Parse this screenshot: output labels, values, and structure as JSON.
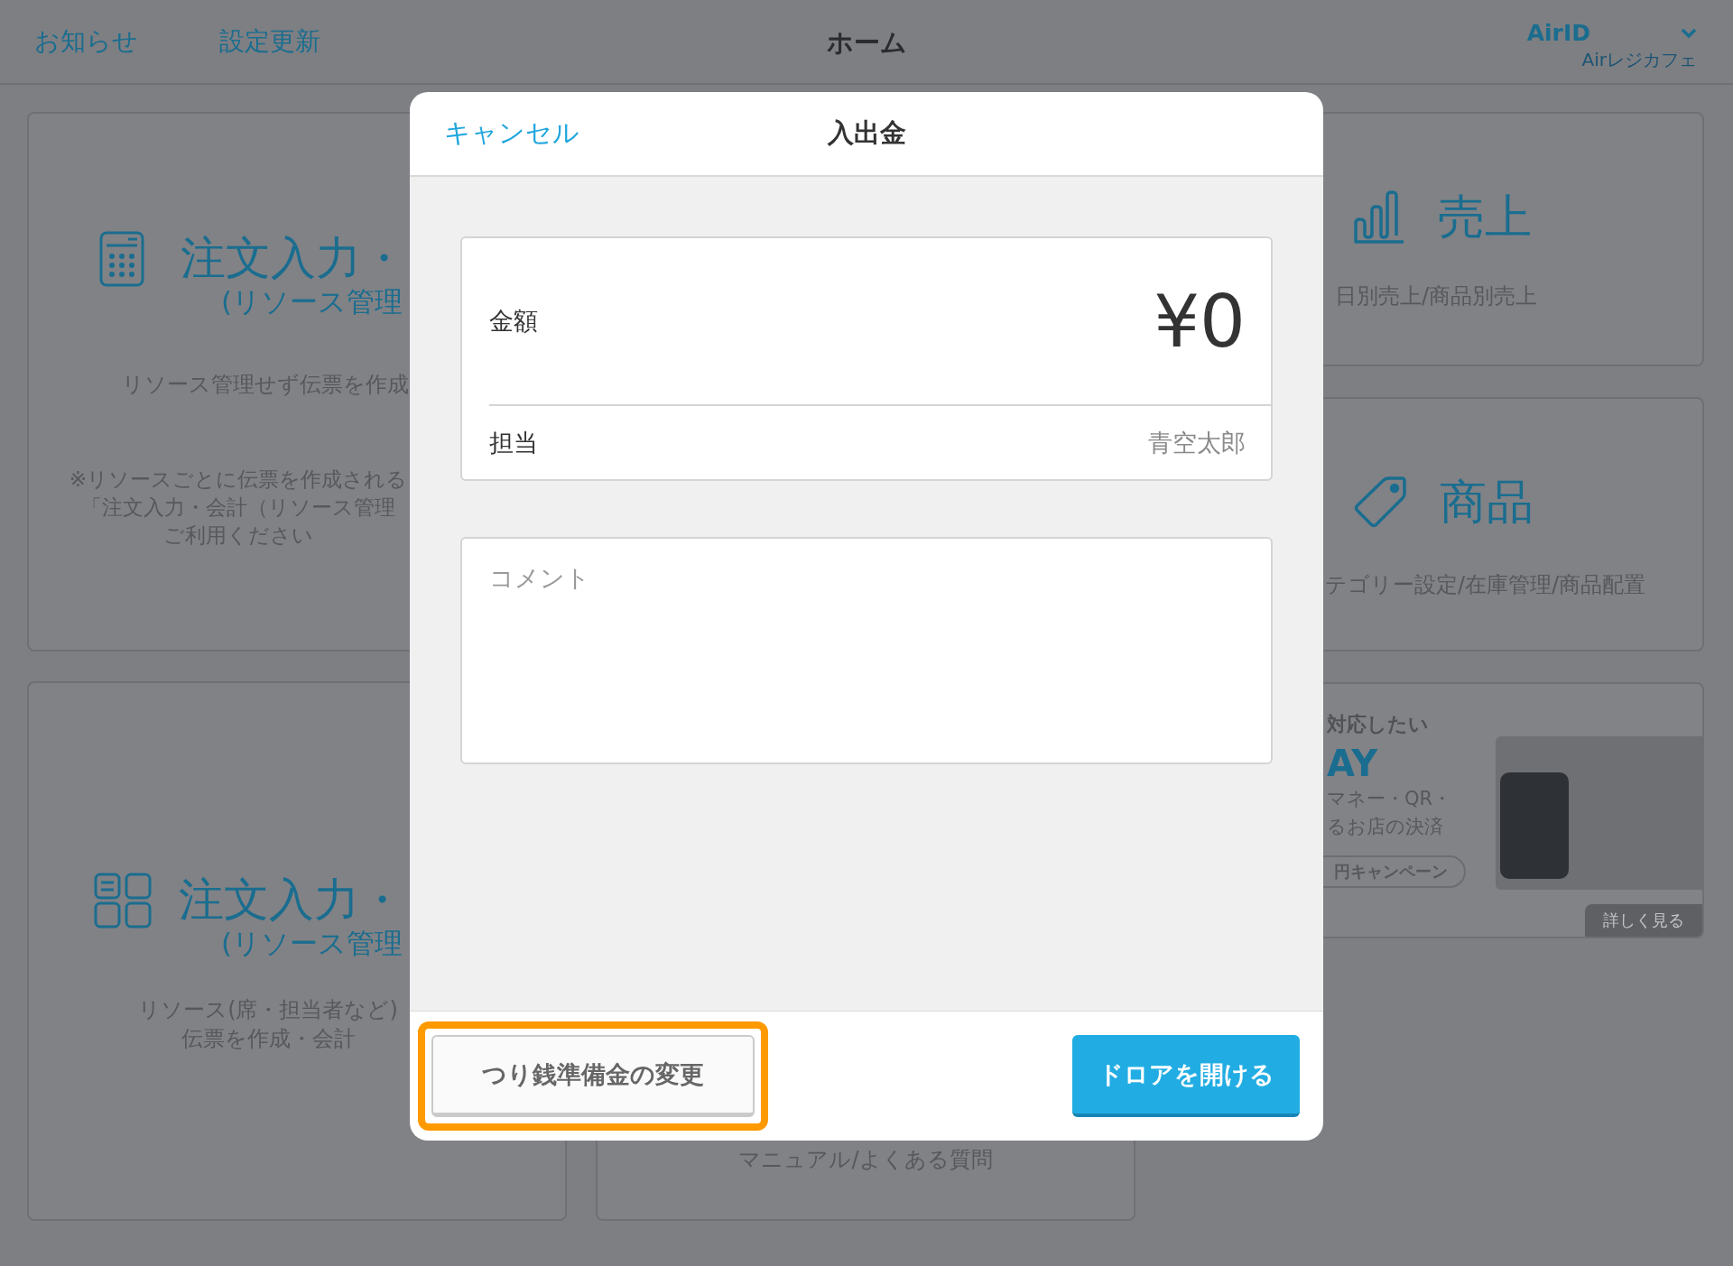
{
  "header": {
    "links": [
      {
        "label": "お知らせ"
      },
      {
        "label": "設定更新"
      }
    ],
    "title": "ホーム",
    "account": {
      "id": "AirID",
      "store": "Airレジカフェ"
    }
  },
  "left_cards": [
    {
      "kind": "calculator",
      "title": "注文入力・",
      "subtitle": "(リソース管理",
      "description": "リソース管理せず伝票を作成",
      "note": [
        "※リソースごとに伝票を作成される",
        "「注文入力・会計（リソース管理",
        "ご利用ください"
      ]
    },
    {
      "kind": "tiles",
      "title": "注文入力・",
      "subtitle": "(リソース管理",
      "description": [
        "リソース(席・担当者など)",
        "伝票を作成・会計"
      ]
    }
  ],
  "center_card": {
    "description": "マニュアル/よくある質問"
  },
  "right_cards": [
    {
      "kind": "bar-chart",
      "title": "売上",
      "description": "日別売上/商品別売上"
    },
    {
      "kind": "tag",
      "title": "商品",
      "description": "テゴリー設定/在庫管理/商品配置"
    }
  ],
  "promo": {
    "headline": "対応したい",
    "logo": "AY",
    "body": [
      "マネー・QR・",
      "るお店の決済"
    ],
    "campaign": "円キャンペーン",
    "more": "詳しく見る"
  },
  "modal": {
    "cancel": "キャンセル",
    "title": "入出金",
    "amount_label": "金額",
    "amount": "¥0",
    "staff_label": "担当",
    "staff": "青空太郎",
    "comment_placeholder": "コメント",
    "buttons": [
      {
        "kind": "secondary",
        "label": "つり銭準備金の変更",
        "highlighted": true
      },
      {
        "kind": "primary",
        "label": "ドロアを開ける",
        "highlighted": false
      }
    ]
  }
}
